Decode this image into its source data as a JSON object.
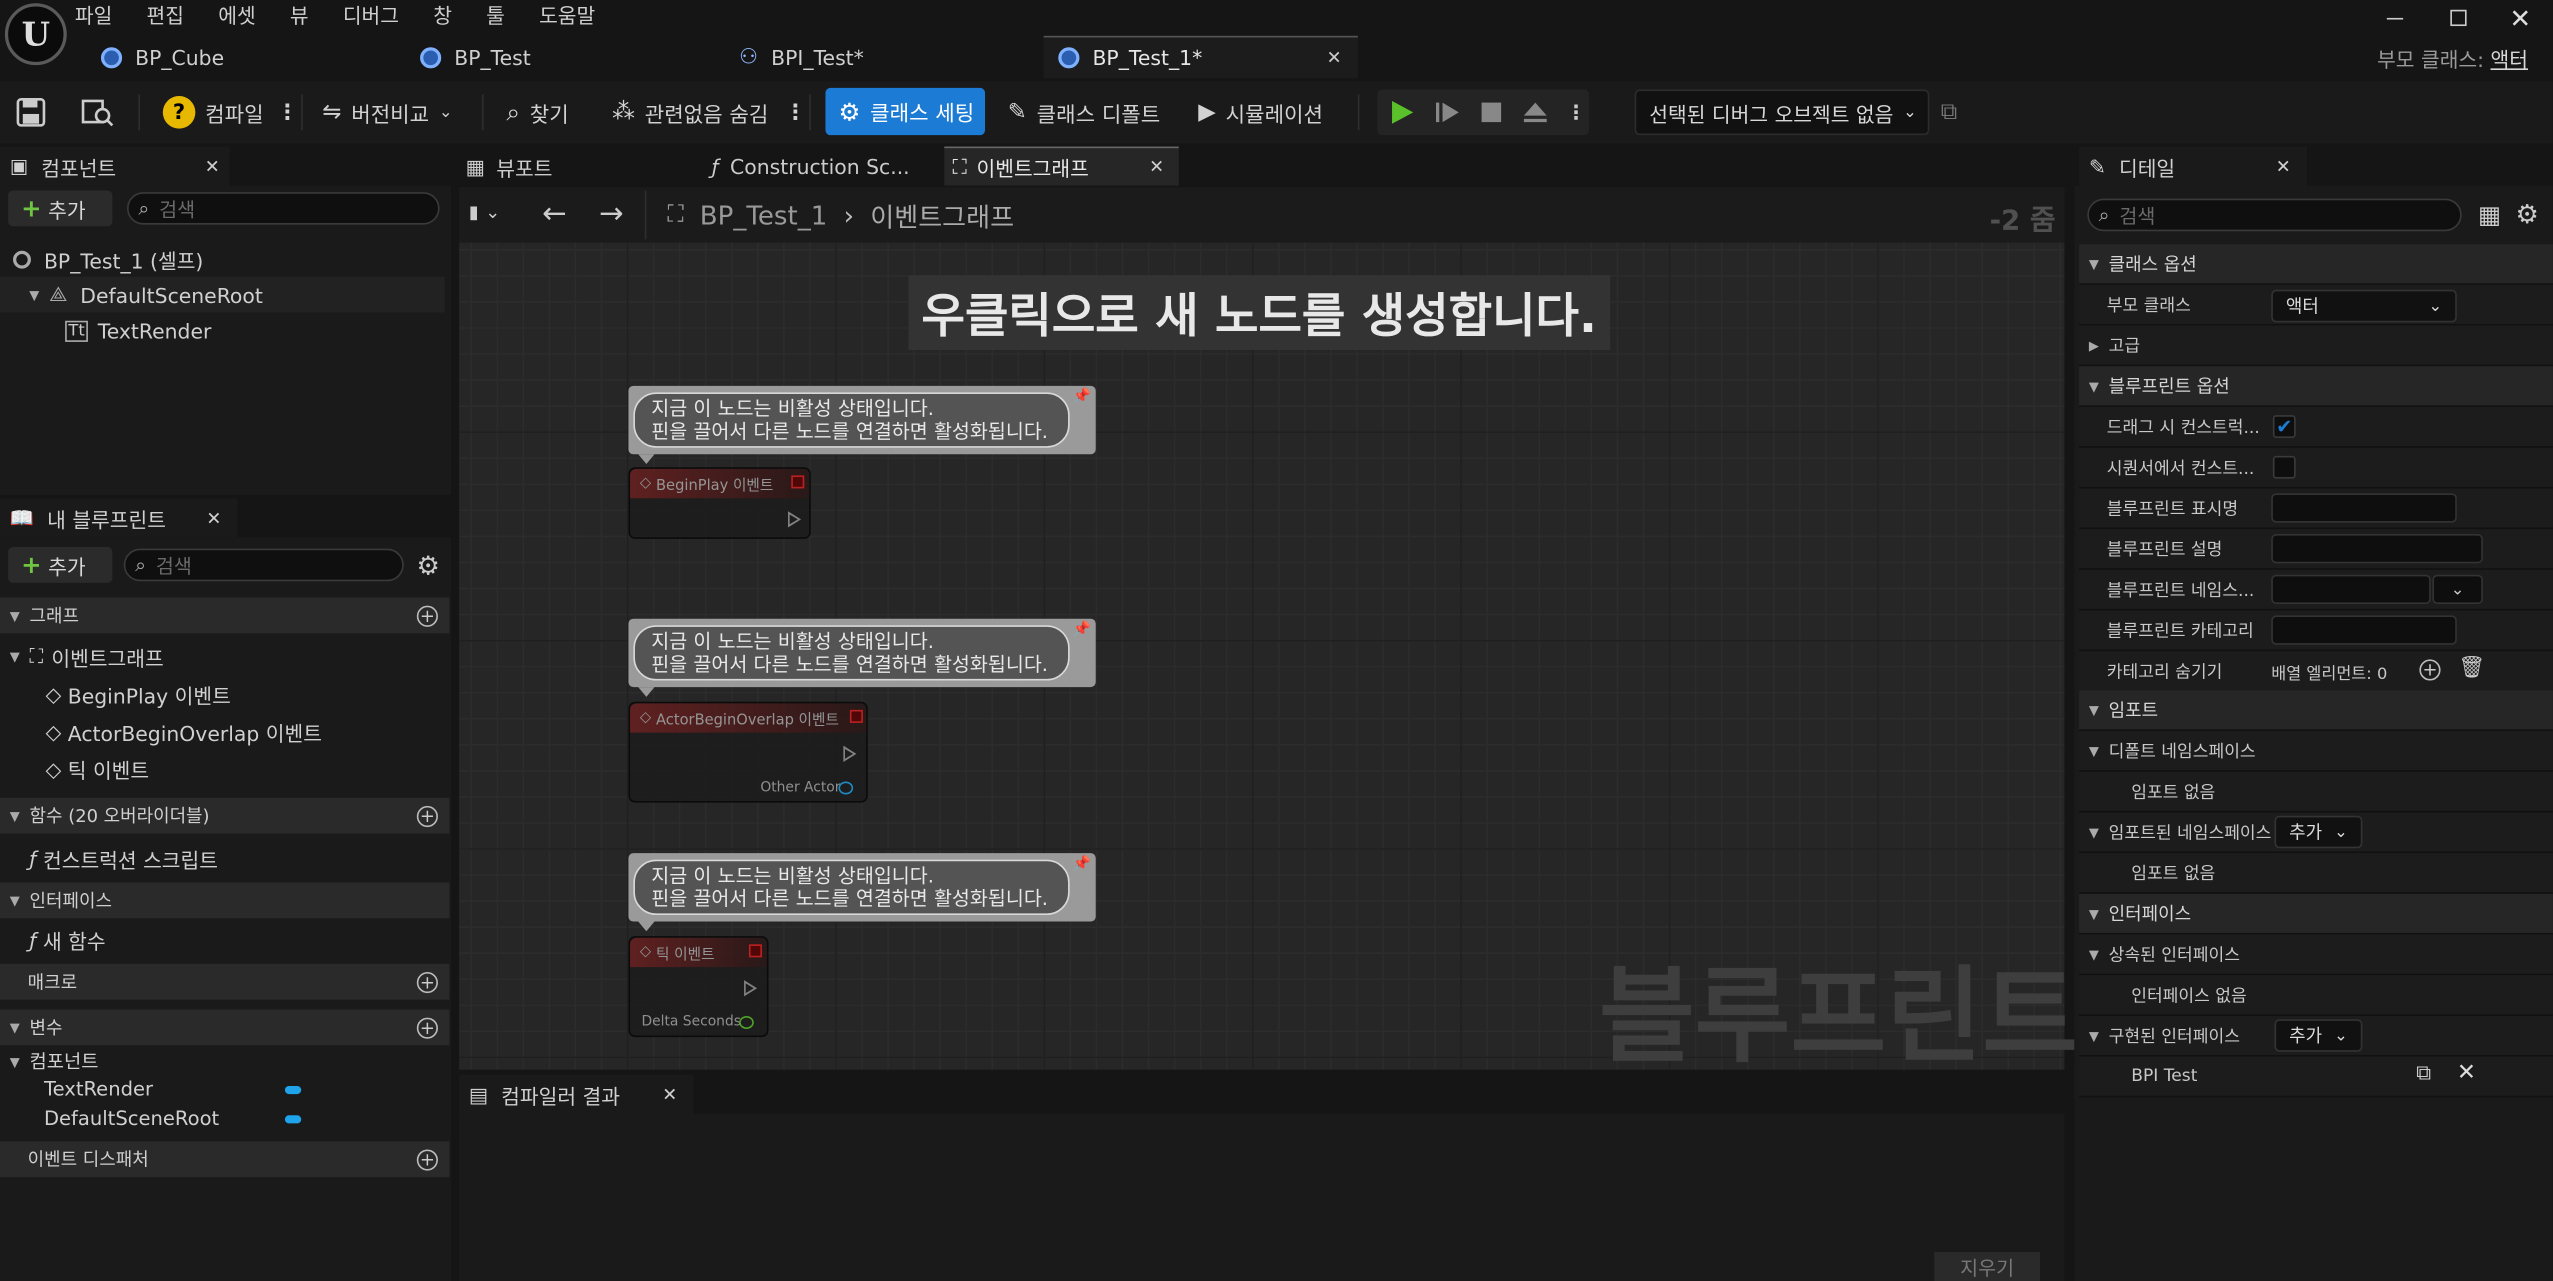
{
  "menu": [
    "파일",
    "편집",
    "에셋",
    "뷰",
    "디버그",
    "창",
    "툴",
    "도움말"
  ],
  "tabs": [
    {
      "label": "BP_Cube"
    },
    {
      "label": "BP_Test"
    },
    {
      "label": "BPI_Test*"
    },
    {
      "label": "BP_Test_1*",
      "active": true
    }
  ],
  "parent_class": {
    "label": "부모 클래스:",
    "value": "액터"
  },
  "toolbar": {
    "compile": "컴파일",
    "diff": "버전비교",
    "find": "찾기",
    "hide_unrelated": "관련없음 숨김",
    "class_settings": "클래스 세팅",
    "class_defaults": "클래스 디폴트",
    "simulation": "시뮬레이션",
    "debug_object": "선택된 디버그 오브젝트 없음"
  },
  "components_panel": {
    "title": "컴포넌트",
    "add": "추가",
    "search_placeholder": "검색",
    "items": [
      "BP_Test_1 (셀프)",
      "DefaultSceneRoot",
      "TextRender"
    ]
  },
  "my_blueprint": {
    "title": "내 블루프린트",
    "add": "추가",
    "search_placeholder": "검색",
    "sections": {
      "graphs": "그래프",
      "functions": "함수 (20 오버라이더블)",
      "interfaces": "인터페이스",
      "macros": "매크로",
      "variables": "변수",
      "dispatchers": "이벤트 디스패처"
    },
    "event_graph": "이벤트그래프",
    "events": [
      "BeginPlay 이벤트",
      "ActorBeginOverlap 이벤트",
      "틱 이벤트"
    ],
    "construction_script": "컨스트럭션 스크립트",
    "new_function": "새 함수",
    "components_category": "컴포넌트",
    "variables": [
      "TextRender",
      "DefaultSceneRoot"
    ]
  },
  "editor_tabs": [
    "뷰포트",
    "Construction Sc...",
    "이벤트그래프"
  ],
  "breadcrumb": {
    "blueprint": "BP_Test_1",
    "graph": "이벤트그래프"
  },
  "zoom": "-2 줌",
  "graph_hint": "우클릭으로 새 노드를 생성합니다.",
  "watermark": "블루프린트",
  "comment_text": [
    "지금 이 노드는 비활성 상태입니다.",
    "핀을 끌어서 다른 노드를 연결하면 활성화됩니다."
  ],
  "nodes": [
    {
      "title": "BeginPlay 이벤트",
      "pin": ""
    },
    {
      "title": "ActorBeginOverlap 이벤트",
      "pin": "Other Actor"
    },
    {
      "title": "틱 이벤트",
      "pin": "Delta Seconds"
    }
  ],
  "compiler": {
    "title": "컴파일러 결과",
    "clear": "지우기"
  },
  "details": {
    "title": "디테일",
    "search_placeholder": "검색",
    "class_options": "클래스 옵션",
    "parent_class_label": "부모 클래스",
    "parent_class_value": "액터",
    "advanced": "고급",
    "bp_options": "블루프린트 옵션",
    "drag_construct": "드래그 시 컨스트럭...",
    "sequencer_construct": "시퀀서에서 컨스트...",
    "display_name": "블루프린트 표시명",
    "description": "블루프린트 설명",
    "namespace": "블루프린트 네임스...",
    "category": "블루프린트 카테고리",
    "hide_categories": "카테고리 숨기기",
    "array_elements": "배열 엘리먼트: 0",
    "imports": "임포트",
    "default_namespace": "디폴트 네임스페이스",
    "no_imports": "임포트 없음",
    "imported_namespace": "임포트된 네임스페이스",
    "add": "추가",
    "interfaces": "인터페이스",
    "inherited_interfaces": "상속된 인터페이스",
    "no_interfaces": "인터페이스 없음",
    "implemented_interfaces": "구현된 인터페이스",
    "bpi_test": "BPI Test",
    "drag_checked": true,
    "sequencer_checked": false
  },
  "colors": {
    "accent": "#1c7bd5",
    "play": "#5ac12a",
    "pin_blue": "#1fa3ea",
    "exec_red": "#e02020"
  }
}
